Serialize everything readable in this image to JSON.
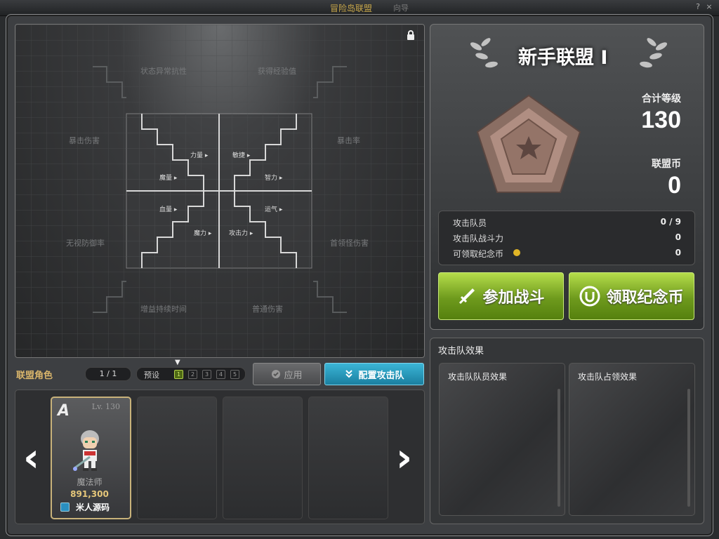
{
  "window": {
    "title": "冒险岛联盟",
    "hint": "向导",
    "help": "?",
    "close": "×"
  },
  "board": {
    "zones": {
      "status_resist": "状态异常抗性",
      "exp_gain": "获得经验值",
      "crit_damage": "暴击伤害",
      "crit_rate": "暴击率",
      "ignore_def": "无视防御率",
      "boss_damage": "首领怪伤害",
      "buff_duration": "增益持续时间",
      "normal_damage": "普通伤害"
    },
    "stats": {
      "str": "力量",
      "dex": "敏捷",
      "mp": "魔量",
      "int": "智力",
      "hp": "血量",
      "luk": "运气",
      "magic": "魔力",
      "attack": "攻击力"
    }
  },
  "league": {
    "name": "新手联盟 I",
    "total_level_label": "合计等级",
    "total_level": "130",
    "coin_label": "联盟币",
    "coin": "0"
  },
  "stats_box": [
    {
      "label": "攻击队员",
      "value": "0 / 9"
    },
    {
      "label": "攻击队战斗力",
      "value": "0"
    },
    {
      "label": "可领取纪念币",
      "value": "0"
    }
  ],
  "buttons": {
    "join_battle": "参加战斗",
    "claim_coin": "领取纪念币",
    "apply": "应用",
    "configure": "配置攻击队"
  },
  "effects": {
    "title": "攻击队效果",
    "member_effect": "攻击队队员效果",
    "occupy_effect": "攻击队占领效果"
  },
  "toolbar": {
    "label": "联盟角色",
    "page": "1 / 1",
    "preset_label": "预设",
    "presets": [
      "1",
      "2",
      "3",
      "4",
      "5"
    ]
  },
  "character": {
    "rank": "A",
    "level": "Lv. 130",
    "job": "魔法师",
    "power": "891,300",
    "name": "米人源码"
  },
  "colors": {
    "gold": "#d9b56b",
    "green": "#7fb52a",
    "blue": "#2a9fc4"
  }
}
